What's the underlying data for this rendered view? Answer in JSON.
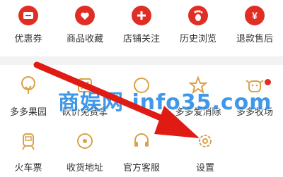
{
  "colors": {
    "accent": "#e02e24",
    "outline": "#d9a24a",
    "watermark": "#1e88e5",
    "arrow": "#e01b14"
  },
  "row1": [
    {
      "label": "优惠券",
      "icon": "coupon-icon"
    },
    {
      "label": "商品收藏",
      "icon": "heart-bag-icon"
    },
    {
      "label": "店铺关注",
      "icon": "store-plus-icon"
    },
    {
      "label": "历史浏览",
      "icon": "footprint-icon"
    },
    {
      "label": "退款售后",
      "icon": "yen-icon"
    }
  ],
  "row2": [
    {
      "label": "多多果园",
      "icon": "tree-icon"
    },
    {
      "label": "砍价免费拿",
      "icon": "cut-price-icon"
    },
    {
      "label": "",
      "icon": "coin-icon"
    },
    {
      "label": "多多爱消除",
      "icon": "star-game-icon"
    },
    {
      "label": "多多牧场",
      "icon": "cow-icon"
    }
  ],
  "row3": [
    {
      "label": "火车票",
      "icon": "train-icon"
    },
    {
      "label": "收货地址",
      "icon": "location-icon"
    },
    {
      "label": "官方客服",
      "icon": "headset-icon"
    },
    {
      "label": "设置",
      "icon": "gear-icon"
    }
  ],
  "watermark": "商娱网 info35.com"
}
